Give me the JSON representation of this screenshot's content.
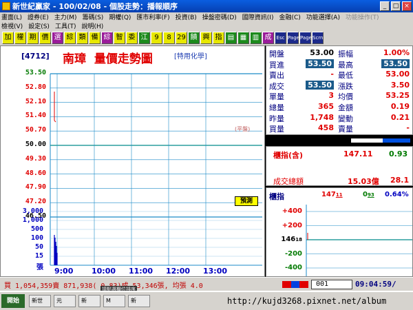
{
  "window": {
    "title": "新世紀贏家 - 100/02/08 - 個股走勢：播報順序"
  },
  "menu": {
    "row1": [
      {
        "label": "畫面(L)",
        "disabled": false
      },
      {
        "label": "證券(E)",
        "disabled": false
      },
      {
        "label": "主力(M)",
        "disabled": false
      },
      {
        "label": "籌碼(S)",
        "disabled": false
      },
      {
        "label": "期權(Q)",
        "disabled": false
      },
      {
        "label": "匯市利率(F)",
        "disabled": false
      },
      {
        "label": "投資(B)",
        "disabled": false
      },
      {
        "label": "操盤密碼(D)",
        "disabled": false
      },
      {
        "label": "國際資訊(I)",
        "disabled": false
      },
      {
        "label": "金融(C)",
        "disabled": false
      },
      {
        "label": "功能選擇(A)",
        "disabled": false
      },
      {
        "label": "功能操作(T)",
        "disabled": true
      }
    ],
    "row2": [
      {
        "label": "檢視(V)",
        "disabled": false
      },
      {
        "label": "設定(S)",
        "disabled": false
      },
      {
        "label": "工具(T)",
        "disabled": false
      },
      {
        "label": "說明(H)",
        "disabled": false
      }
    ]
  },
  "toolbar": [
    {
      "label": "加",
      "style": "y"
    },
    {
      "label": "權",
      "style": "y"
    },
    {
      "label": "期",
      "style": "y"
    },
    {
      "label": "價",
      "style": "y"
    },
    {
      "label": "選",
      "style": "p"
    },
    {
      "label": "綜",
      "style": "y"
    },
    {
      "label": "類",
      "style": "y"
    },
    {
      "label": "備",
      "style": "y"
    },
    {
      "label": "綜",
      "style": "p"
    },
    {
      "label": "智",
      "style": "y"
    },
    {
      "label": "委",
      "style": "y"
    },
    {
      "label": "江",
      "style": "g"
    },
    {
      "label": "9",
      "style": "y"
    },
    {
      "label": "8",
      "style": "y"
    },
    {
      "label": "29",
      "style": "y"
    },
    {
      "label": "饋",
      "style": "g"
    },
    {
      "label": "興",
      "style": "y"
    },
    {
      "label": "指",
      "style": "y"
    },
    {
      "label": "▤",
      "style": "g"
    },
    {
      "label": "▦",
      "style": "g"
    },
    {
      "label": "▥",
      "style": "g"
    },
    {
      "label": "成",
      "style": "p"
    },
    {
      "label": "Esc",
      "style": "b"
    },
    {
      "label": "Page",
      "style": "b"
    },
    {
      "label": "Page",
      "style": "b"
    },
    {
      "label": "Scrn",
      "style": "b"
    }
  ],
  "stock": {
    "code": "[4712]",
    "name": "南璋",
    "chart_title": "量價走勢圖",
    "industry": "[特用化學]"
  },
  "chart": {
    "price_labels": [
      {
        "text": "53.50",
        "color": "green"
      },
      {
        "text": "52.80",
        "color": "red"
      },
      {
        "text": "52.10",
        "color": "red"
      },
      {
        "text": "51.40",
        "color": "red"
      },
      {
        "text": "50.70",
        "color": "red"
      },
      {
        "text": "50.00",
        "color": "blk"
      },
      {
        "text": "49.30",
        "color": "red"
      },
      {
        "text": "48.60",
        "color": "red"
      },
      {
        "text": "47.90",
        "color": "red"
      },
      {
        "text": "47.20",
        "color": "red"
      },
      {
        "text": "46.50",
        "color": "blk"
      }
    ],
    "volume_labels": [
      "3,000",
      "1,000",
      "500",
      "100",
      "50",
      "15",
      "張"
    ],
    "time_labels": [
      "9:00",
      "10:00",
      "11:00",
      "12:00",
      "13:00"
    ],
    "flat_tag": "(平盤)",
    "trial_badge": "預測"
  },
  "info": {
    "rows": [
      {
        "l1": "開盤",
        "v1": "53.00",
        "c1": "blk",
        "l2": "振幅",
        "v2": "1.00%",
        "c2": "red",
        "b1": false,
        "b2": false
      },
      {
        "l1": "買進",
        "v1": "53.50",
        "c1": "box",
        "l2": "最高",
        "v2": "53.50",
        "c2": "box",
        "b1": true,
        "b2": true
      },
      {
        "l1": "賣出",
        "v1": "-",
        "c1": "red",
        "l2": "最低",
        "v2": "53.00",
        "c2": "red",
        "b1": false,
        "b2": false
      },
      {
        "l1": "成交",
        "v1": "53.50",
        "c1": "box",
        "l2": "漲跌",
        "v2": "3.50",
        "c2": "red",
        "b1": true,
        "b2": false
      },
      {
        "l1": "單量",
        "v1": "3",
        "c1": "red",
        "l2": "均價",
        "v2": "53.25",
        "c2": "red",
        "b1": false,
        "b2": false
      },
      {
        "l1": "總量",
        "v1": "365",
        "c1": "red",
        "l2": "金額",
        "v2": "0.19",
        "c2": "red",
        "b1": false,
        "b2": false
      },
      {
        "l1": "昨量",
        "v1": "1,748",
        "c1": "red",
        "l2": "變動",
        "v2": "0.21",
        "c2": "red",
        "b1": false,
        "b2": false
      },
      {
        "l1": "買量",
        "v1": "458",
        "c1": "red",
        "l2": "賣量",
        "v2": "-",
        "c2": "red",
        "b1": false,
        "b2": false
      }
    ]
  },
  "index": {
    "label": "櫃指(含)",
    "value": "147.11",
    "change": "0.93",
    "turnover_label": "成交總額",
    "turnover_value": "15.03億",
    "turnover_change": "28.1"
  },
  "mini": {
    "label": "櫃指",
    "value": "147",
    "value_frac": "11",
    "change": "0",
    "change_frac": "93",
    "pct": "0.64%",
    "scale": [
      "+400",
      "+200",
      "146",
      "-200",
      "-400"
    ],
    "base_frac": "18"
  },
  "status": {
    "text": "買 1,054,359賣 871,938( 0.83)成 53,346張, 均張 4.0",
    "tip": "請點選欄位排序",
    "code": "001",
    "clock": "09:04:59/"
  },
  "taskbar": {
    "start": "開始",
    "tasks": [
      "新世",
      "元",
      "新",
      "M",
      "新"
    ],
    "watermark": "http://kujd3268.pixnet.net/album"
  },
  "colors": {
    "up": "#e00000",
    "down": "#007a00",
    "flat": "#000000",
    "grid": "#1a8ac8"
  }
}
